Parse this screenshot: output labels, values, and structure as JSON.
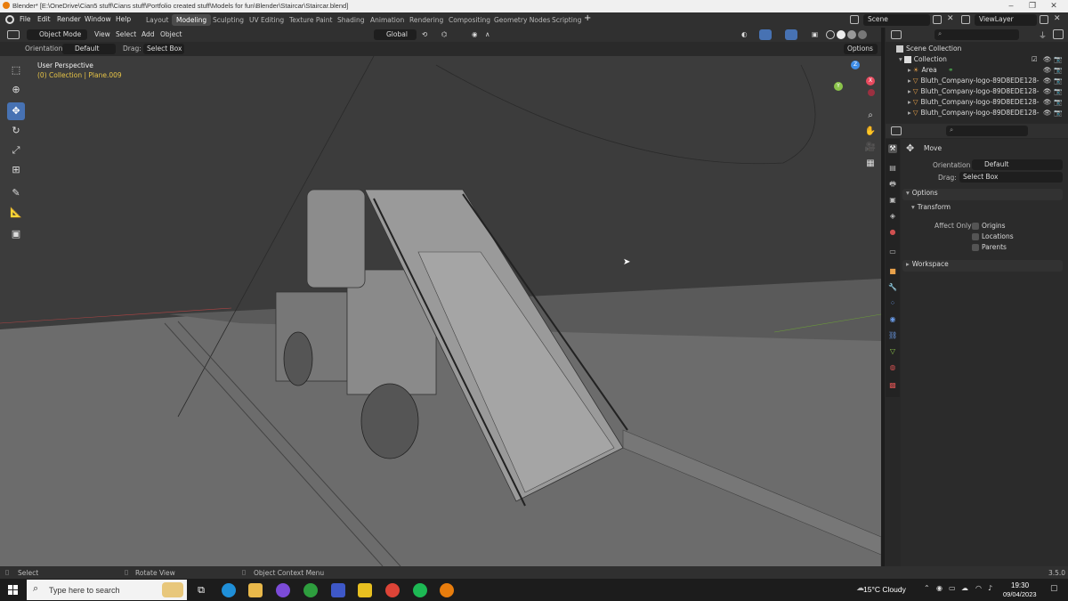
{
  "window": {
    "title": "Blender* [E:\\OneDrive\\Cian5 stuff\\Cians stuff\\Portfolio created stuff\\Models for fun\\Blender\\Staircar\\Staircar.blend]"
  },
  "menu": {
    "items": [
      "File",
      "Edit",
      "Render",
      "Window",
      "Help"
    ],
    "workspaces": [
      "Layout",
      "Modeling",
      "Sculpting",
      "UV Editing",
      "Texture Paint",
      "Shading",
      "Animation",
      "Rendering",
      "Compositing",
      "Geometry Nodes",
      "Scripting"
    ],
    "active_workspace": "Modeling",
    "scene": "Scene",
    "view_layer": "ViewLayer"
  },
  "viewport_header": {
    "mode": "Object Mode",
    "menus": [
      "View",
      "Select",
      "Add",
      "Object"
    ],
    "transform_orientation": "Global",
    "orientation_label": "Orientation:",
    "orientation_value": "Default",
    "drag_label": "Drag:",
    "drag_value": "Select Box",
    "options": "Options"
  },
  "viewport": {
    "view_name": "User Perspective",
    "collection_info": "(0) Collection | Plane.009",
    "gizmo_axes": [
      "X",
      "Y",
      "Z"
    ]
  },
  "outliner": {
    "root": "Scene Collection",
    "collection": "Collection",
    "items": [
      {
        "name": "Area",
        "icon": "light-icon"
      },
      {
        "name": "Bluth_Company-logo-89D8EDE128-",
        "icon": "mesh-icon"
      },
      {
        "name": "Bluth_Company-logo-89D8EDE128-",
        "icon": "mesh-icon"
      },
      {
        "name": "Bluth_Company-logo-89D8EDE128-",
        "icon": "mesh-icon"
      },
      {
        "name": "Bluth_Company-logo-89D8EDE128-",
        "icon": "mesh-icon"
      }
    ]
  },
  "properties": {
    "tool_name": "Move",
    "orientation_label": "Orientation",
    "orientation_value": "Default",
    "drag_label": "Drag:",
    "drag_value": "Select Box",
    "options_panel": "Options",
    "transform_panel": "Transform",
    "affect_only_label": "Affect Only",
    "affect_options": [
      "Origins",
      "Locations",
      "Parents"
    ],
    "workspace_panel": "Workspace"
  },
  "statusbar": {
    "left": "Select",
    "middle": "Rotate View",
    "right": "Object Context Menu",
    "version": "3.5.0"
  },
  "taskbar": {
    "search_placeholder": "Type here to search",
    "weather": "15°C  Cloudy",
    "time": "19:30",
    "date": "09/04/2023"
  },
  "colors": {
    "accent": "#4772b3",
    "viewport_bg": "#3c3c3c",
    "info_yellow": "#e8c547",
    "x_axis": "#e84a5f",
    "y_axis": "#8bc34a",
    "z_axis": "#3f8ee8"
  }
}
